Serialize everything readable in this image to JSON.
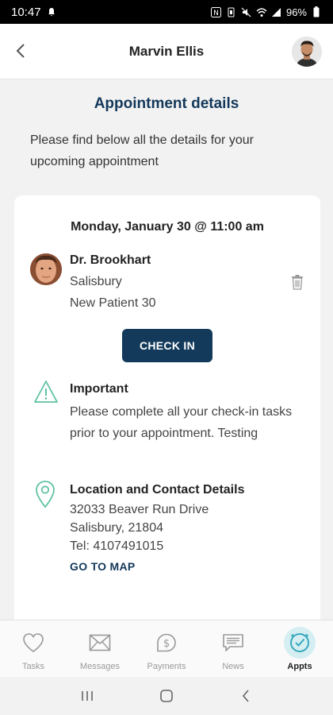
{
  "status_bar": {
    "time": "10:47",
    "battery": "96%"
  },
  "header": {
    "title": "Marvin Ellis"
  },
  "page": {
    "heading": "Appointment details",
    "intro": "Please find below all the details for your upcoming appointment"
  },
  "appointment": {
    "datetime": "Monday, January 30 @ 11:00 am",
    "doctor_name": "Dr. Brookhart",
    "location": "Salisbury",
    "type": "New Patient 30",
    "check_in_label": "CHECK IN"
  },
  "important": {
    "title": "Important",
    "text": "Please complete all your check-in tasks prior to your appointment. Testing"
  },
  "location": {
    "title": "Location and Contact Details",
    "street": "32033 Beaver Run Drive",
    "city": "Salisbury, 21804",
    "tel": "Tel: 4107491015",
    "map_link": "GO TO MAP"
  },
  "bottom_nav": {
    "items": [
      {
        "label": "Tasks",
        "icon": "heart-icon"
      },
      {
        "label": "Messages",
        "icon": "envelope-icon"
      },
      {
        "label": "Payments",
        "icon": "dollar-icon"
      },
      {
        "label": "News",
        "icon": "news-icon"
      },
      {
        "label": "Appts",
        "icon": "clock-check-icon",
        "active": true
      }
    ]
  },
  "colors": {
    "primary": "#133a5b",
    "accent": "#5fc2a4",
    "active_nav_bg": "#d4eef2"
  }
}
